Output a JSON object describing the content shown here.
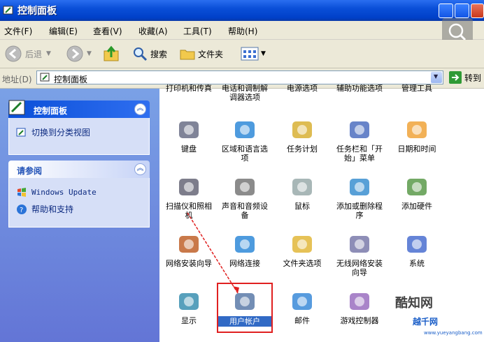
{
  "window": {
    "title": "控制面板"
  },
  "menu": [
    "文件(F)",
    "编辑(E)",
    "查看(V)",
    "收藏(A)",
    "工具(T)",
    "帮助(H)"
  ],
  "toolbar": {
    "back": "后退",
    "search": "搜索",
    "folders": "文件夹"
  },
  "address": {
    "label": "地址(D)",
    "value": "控制面板",
    "go": "转到"
  },
  "sidebar": {
    "panel1": {
      "title": "控制面板",
      "link": "切换到分类视图"
    },
    "panel2": {
      "title": "请参阅",
      "links": [
        "Windows Update",
        "帮助和支持"
      ]
    }
  },
  "items": [
    {
      "label": "打印机和传真",
      "icon": "printer-icon"
    },
    {
      "label": "电话和调制解调器选项",
      "icon": "phone-icon"
    },
    {
      "label": "电源选项",
      "icon": "power-icon"
    },
    {
      "label": "辅助功能选项",
      "icon": "accessibility-icon"
    },
    {
      "label": "管理工具",
      "icon": "admin-tools-icon"
    },
    {
      "label": "键盘",
      "icon": "keyboard-icon"
    },
    {
      "label": "区域和语言选项",
      "icon": "globe-icon"
    },
    {
      "label": "任务计划",
      "icon": "scheduled-tasks-icon"
    },
    {
      "label": "任务栏和「开始」菜单",
      "icon": "taskbar-icon"
    },
    {
      "label": "日期和时间",
      "icon": "clock-icon"
    },
    {
      "label": "扫描仪和照相机",
      "icon": "scanner-icon"
    },
    {
      "label": "声音和音频设备",
      "icon": "speaker-icon"
    },
    {
      "label": "鼠标",
      "icon": "mouse-icon"
    },
    {
      "label": "添加或删除程序",
      "icon": "add-remove-icon"
    },
    {
      "label": "添加硬件",
      "icon": "hardware-icon"
    },
    {
      "label": "网络安装向导",
      "icon": "network-wizard-icon"
    },
    {
      "label": "网络连接",
      "icon": "network-icon"
    },
    {
      "label": "文件夹选项",
      "icon": "folder-options-icon"
    },
    {
      "label": "无线网络安装向导",
      "icon": "wireless-icon"
    },
    {
      "label": "系统",
      "icon": "system-icon"
    },
    {
      "label": "显示",
      "icon": "display-icon"
    },
    {
      "label": "用户帐户",
      "icon": "users-icon"
    },
    {
      "label": "邮件",
      "icon": "mail-icon"
    },
    {
      "label": "游戏控制器",
      "icon": "gamepad-icon"
    }
  ],
  "watermark": {
    "name": "酷知网",
    "site": "越千网",
    "url": "www.yueyangbang.com"
  },
  "colors": {
    "titlebar": "#0a4fd8",
    "sidebar": "#6f8ee0",
    "highlight": "#e02020",
    "selection": "#316ac5"
  }
}
